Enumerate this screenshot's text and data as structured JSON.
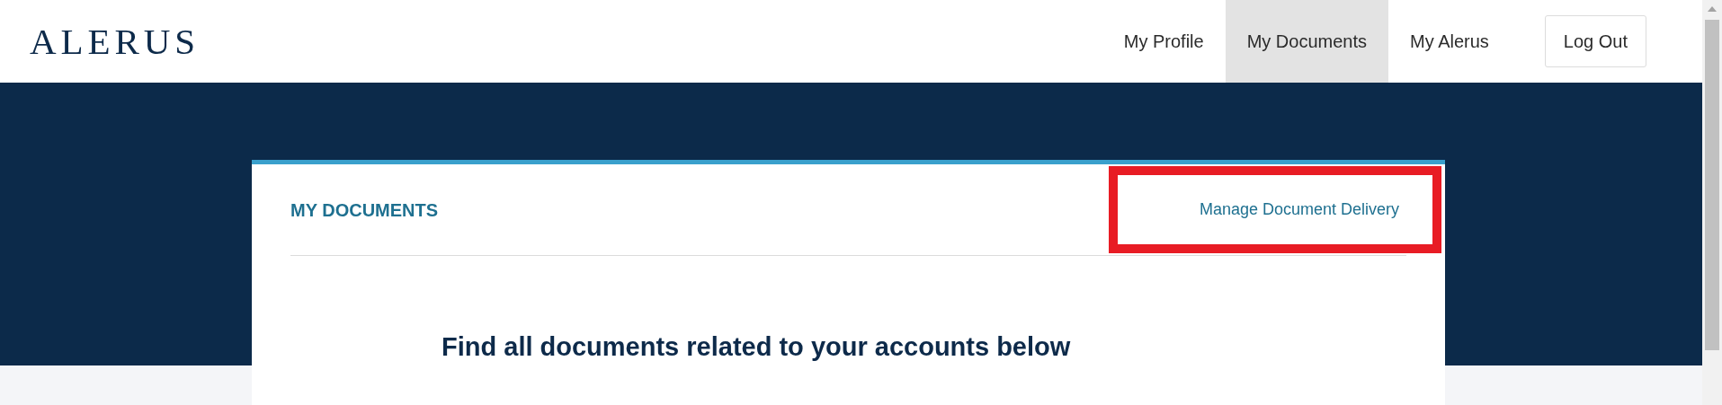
{
  "logo": {
    "text": "ALERUS"
  },
  "nav": [
    {
      "label": "My Profile",
      "selected": false
    },
    {
      "label": "My Documents",
      "selected": true
    },
    {
      "label": "My Alerus",
      "selected": false
    }
  ],
  "logout_button": "Log Out",
  "card": {
    "title": "MY DOCUMENTS",
    "link": {
      "label": "Manage Document Delivery",
      "highlighted": true
    },
    "heading": "Find all documents related to your accounts below"
  }
}
